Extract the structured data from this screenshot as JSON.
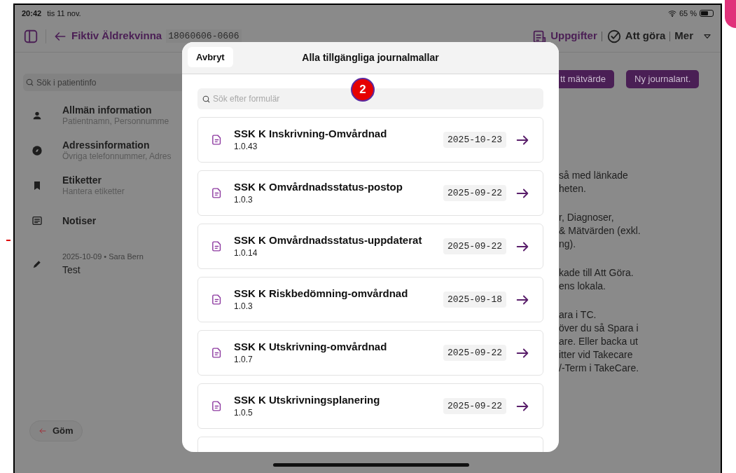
{
  "status_bar": {
    "time": "20:42",
    "date": "tis 11 nov.",
    "battery": "65 %"
  },
  "header": {
    "patient_name": "Fiktiv Äldrekvinna",
    "personal_number": "18060606-0606",
    "actions": [
      {
        "kind": "tasks",
        "label": "Uppgifter"
      },
      {
        "kind": "todo",
        "label": "Att göra"
      },
      {
        "kind": "more",
        "label": "Mer"
      }
    ]
  },
  "sidebar": {
    "search_placeholder": "Sök i patientinfo",
    "items": [
      {
        "kind": "person",
        "title": "Allmän information",
        "subtitle": "Patientnamn, Personnumme"
      },
      {
        "kind": "compass",
        "title": "Adressinformation",
        "subtitle": "Övriga telefonnummer, Adres"
      },
      {
        "kind": "bookmark",
        "title": "Etiketter",
        "subtitle": "Hantera etiketter"
      },
      {
        "kind": "notes",
        "title": "Notiser"
      }
    ],
    "note": {
      "meta": "2025-10-09 • Sara Bern",
      "text": "Test"
    },
    "hide_button": "Göm"
  },
  "toolbar_buttons": [
    "tt mätvärde",
    "Ny journalant."
  ],
  "info_paragraphs": [
    "så med länkade\nheten.",
    "r, Diagnoser,\n& Mätvärden (exkl.\nng).",
    "kade till Att Göra.\nens lokala.",
    "ara i TC.\növer du så Spara i\nare. Eller backa ut\nitter vid Takecare\n/-Term i TakeCare."
  ],
  "modal": {
    "cancel": "Avbryt",
    "title": "Alla tillgängliga journalmallar",
    "search_placeholder": "Sök efter formulär",
    "templates": [
      {
        "name": "SSK K Inskrivning-Omvårdnad",
        "version": "1.0.43",
        "date": "2025-10-23"
      },
      {
        "name": "SSK K Omvårdnadsstatus-postop",
        "version": "1.0.3",
        "date": "2025-09-22"
      },
      {
        "name": "SSK K Omvårdnadsstatus-uppdaterat",
        "version": "1.0.14",
        "date": "2025-09-22"
      },
      {
        "name": "SSK K Riskbedömning-omvårdnad",
        "version": "1.0.3",
        "date": "2025-09-18"
      },
      {
        "name": "SSK K Utskrivning-omvårdnad",
        "version": "1.0.7",
        "date": "2025-09-22"
      },
      {
        "name": "SSK K Utskrivningsplanering",
        "version": "1.0.5",
        "date": "2025-09-22"
      }
    ]
  },
  "annotation": {
    "label": "2"
  }
}
